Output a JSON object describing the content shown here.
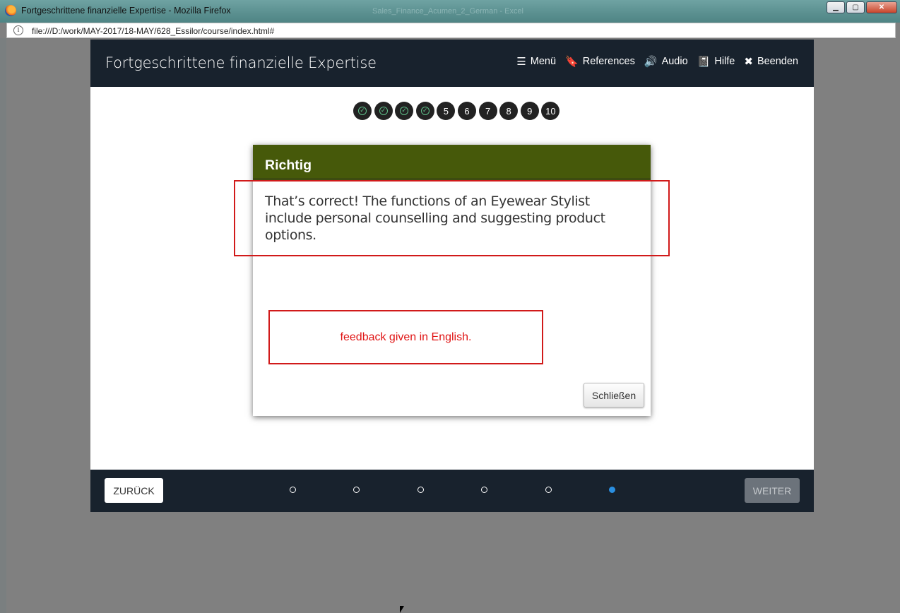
{
  "window": {
    "title": "Fortgeschrittene finanzielle Expertise - Mozilla Firefox",
    "ghost_title": "Sales_Finance_Acumen_2_German - Excel",
    "minimize": "▁",
    "maximize": "▢",
    "close": "✕",
    "url": "file:///D:/work/MAY-2017/18-MAY/628_Essilor/course/index.html#",
    "info": "i"
  },
  "header": {
    "title": "Fortgeschrittene finanzielle Expertise",
    "nav": [
      {
        "label": "Menü",
        "icon": "☰"
      },
      {
        "label": "References",
        "icon": "🔖"
      },
      {
        "label": "Audio",
        "icon": "🔊"
      },
      {
        "label": "Hilfe",
        "icon": "📓"
      },
      {
        "label": "Beenden",
        "icon": "✖"
      }
    ]
  },
  "progress": {
    "steps": [
      {
        "label": "✓",
        "completed": true
      },
      {
        "label": "✓",
        "completed": true
      },
      {
        "label": "✓",
        "completed": true
      },
      {
        "label": "✓",
        "completed": true
      },
      {
        "label": "5",
        "completed": false
      },
      {
        "label": "6",
        "completed": false
      },
      {
        "label": "7",
        "completed": false
      },
      {
        "label": "8",
        "completed": false
      },
      {
        "label": "9",
        "completed": false
      },
      {
        "label": "10",
        "completed": false
      }
    ]
  },
  "modal": {
    "title": "Richtig",
    "body": "That’s correct! The functions of an Eyewear Stylist include personal counselling and suggesting product options.",
    "close_label": "Schließen"
  },
  "annotation": {
    "text": "feedback given in English."
  },
  "footer": {
    "back_label": "ZURÜCK",
    "next_label": "WEITER",
    "dots": 6,
    "active_dot": 6
  },
  "colors": {
    "header_bg": "#18222d",
    "modal_head": "#46590a",
    "annotation": "#d11a1a",
    "active_dot": "#2a8fe0"
  }
}
